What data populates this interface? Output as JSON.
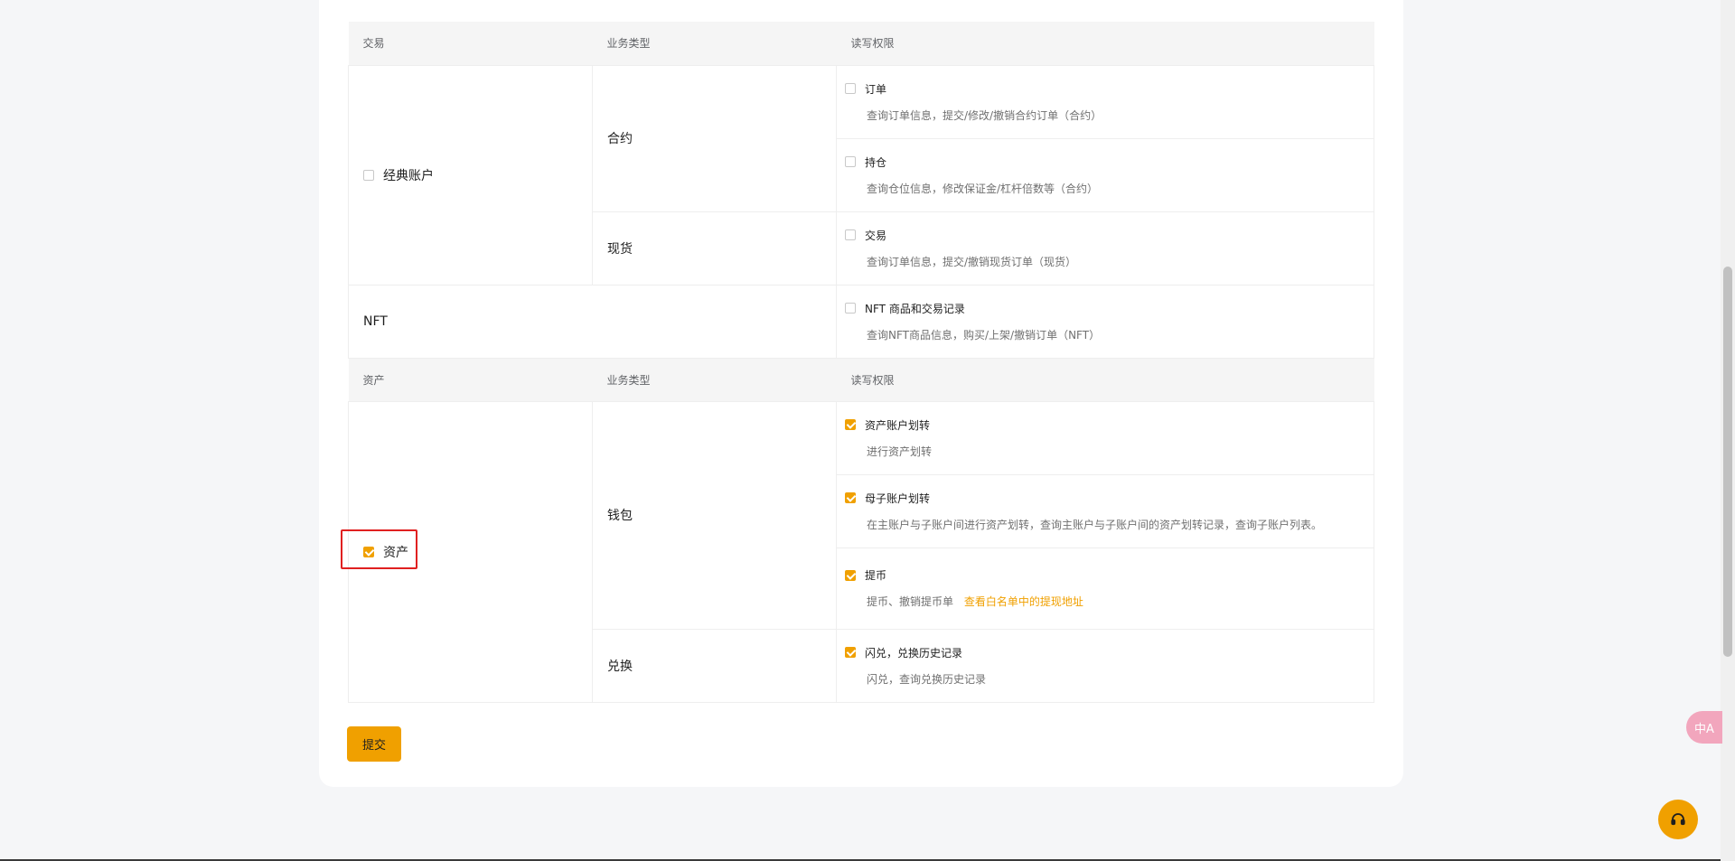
{
  "trade_section": {
    "header": {
      "group": "交易",
      "biz_type": "业务类型",
      "permission": "读写权限"
    },
    "classic_account": {
      "label": "经典账户",
      "checked": false,
      "contract": {
        "label": "合约",
        "order": {
          "title": "订单",
          "desc": "查询订单信息，提交/修改/撤销合约订单（合约）",
          "checked": false
        },
        "position": {
          "title": "持仓",
          "desc": "查询仓位信息，修改保证金/杠杆倍数等（合约）",
          "checked": false
        }
      },
      "spot": {
        "label": "现货",
        "trade": {
          "title": "交易",
          "desc": "查询订单信息，提交/撤销现货订单（现货）",
          "checked": false
        }
      }
    },
    "nft": {
      "label": "NFT",
      "records": {
        "title": "NFT 商品和交易记录",
        "desc": "查询NFT商品信息，购买/上架/撤销订单（NFT）",
        "checked": false
      }
    }
  },
  "asset_section": {
    "header": {
      "group": "资产",
      "biz_type": "业务类型",
      "permission": "读写权限"
    },
    "asset": {
      "label": "资产",
      "checked": true,
      "wallet": {
        "label": "钱包",
        "transfer": {
          "title": "资产账户划转",
          "desc": "进行资产划转",
          "checked": true
        },
        "sub_transfer": {
          "title": "母子账户划转",
          "desc": "在主账户与子账户间进行资产划转，查询主账户与子账户间的资产划转记录，查询子账户列表。",
          "checked": true
        },
        "withdraw": {
          "title": "提币",
          "desc": "提币、撤销提币单",
          "link": "查看白名单中的提现地址",
          "checked": true
        }
      },
      "convert": {
        "label": "兑换",
        "history": {
          "title": "闪兑，兑换历史记录",
          "desc": "闪兑，查询兑换历史记录",
          "checked": true
        }
      }
    }
  },
  "submit_label": "提交",
  "translate_label": "中A",
  "colors": {
    "accent": "#f0a000",
    "highlight": "#e02020",
    "header_bg": "#f5f5f5"
  }
}
